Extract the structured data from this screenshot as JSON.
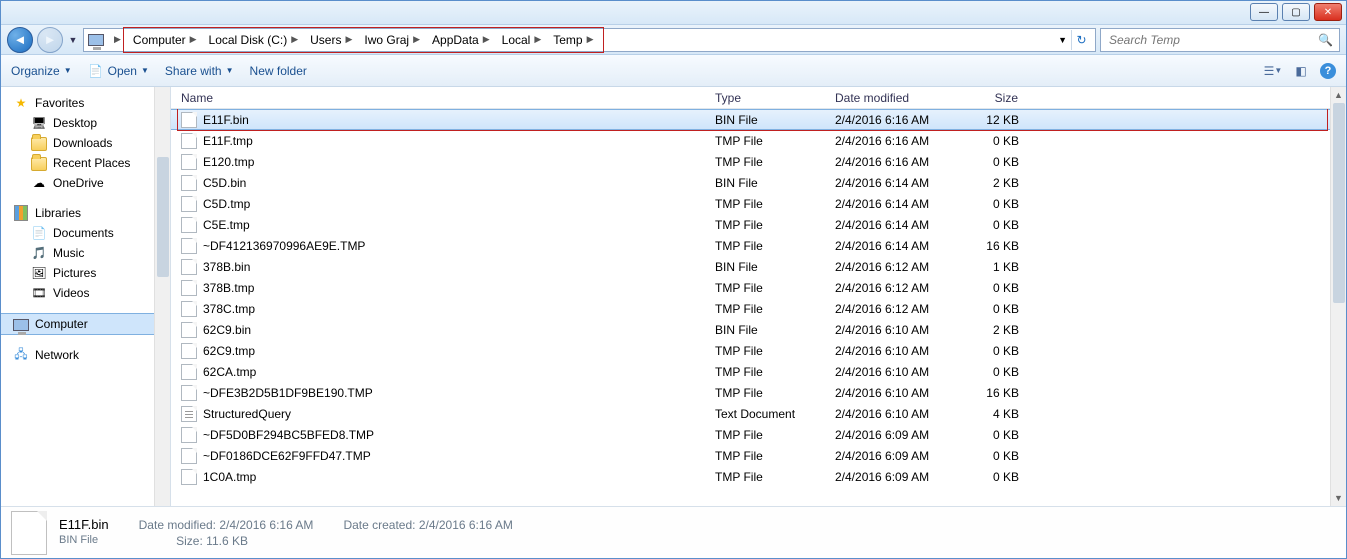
{
  "window": {
    "min": "—",
    "max": "▢",
    "close": "✕"
  },
  "breadcrumbs": [
    "Computer",
    "Local Disk (C:)",
    "Users",
    "Iwo Graj",
    "AppData",
    "Local",
    "Temp"
  ],
  "search": {
    "placeholder": "Search Temp"
  },
  "toolbar": {
    "organize": "Organize",
    "open": "Open",
    "share": "Share with",
    "newfolder": "New folder"
  },
  "sidebar": {
    "favorites": {
      "label": "Favorites",
      "items": [
        {
          "label": "Desktop",
          "icon": "desktop"
        },
        {
          "label": "Downloads",
          "icon": "folder"
        },
        {
          "label": "Recent Places",
          "icon": "folder"
        },
        {
          "label": "OneDrive",
          "icon": "cloud"
        }
      ]
    },
    "libraries": {
      "label": "Libraries",
      "items": [
        {
          "label": "Documents",
          "icon": "doc"
        },
        {
          "label": "Music",
          "icon": "music"
        },
        {
          "label": "Pictures",
          "icon": "pic"
        },
        {
          "label": "Videos",
          "icon": "vid"
        }
      ]
    },
    "computer": {
      "label": "Computer"
    },
    "network": {
      "label": "Network"
    }
  },
  "columns": {
    "name": "Name",
    "type": "Type",
    "date": "Date modified",
    "size": "Size"
  },
  "files": [
    {
      "name": "E11F.bin",
      "type": "BIN File",
      "date": "2/4/2016 6:16 AM",
      "size": "12 KB",
      "selected": true
    },
    {
      "name": "E11F.tmp",
      "type": "TMP File",
      "date": "2/4/2016 6:16 AM",
      "size": "0 KB"
    },
    {
      "name": "E120.tmp",
      "type": "TMP File",
      "date": "2/4/2016 6:16 AM",
      "size": "0 KB"
    },
    {
      "name": "C5D.bin",
      "type": "BIN File",
      "date": "2/4/2016 6:14 AM",
      "size": "2 KB"
    },
    {
      "name": "C5D.tmp",
      "type": "TMP File",
      "date": "2/4/2016 6:14 AM",
      "size": "0 KB"
    },
    {
      "name": "C5E.tmp",
      "type": "TMP File",
      "date": "2/4/2016 6:14 AM",
      "size": "0 KB"
    },
    {
      "name": "~DF412136970996AE9E.TMP",
      "type": "TMP File",
      "date": "2/4/2016 6:14 AM",
      "size": "16 KB"
    },
    {
      "name": "378B.bin",
      "type": "BIN File",
      "date": "2/4/2016 6:12 AM",
      "size": "1 KB"
    },
    {
      "name": "378B.tmp",
      "type": "TMP File",
      "date": "2/4/2016 6:12 AM",
      "size": "0 KB"
    },
    {
      "name": "378C.tmp",
      "type": "TMP File",
      "date": "2/4/2016 6:12 AM",
      "size": "0 KB"
    },
    {
      "name": "62C9.bin",
      "type": "BIN File",
      "date": "2/4/2016 6:10 AM",
      "size": "2 KB"
    },
    {
      "name": "62C9.tmp",
      "type": "TMP File",
      "date": "2/4/2016 6:10 AM",
      "size": "0 KB"
    },
    {
      "name": "62CA.tmp",
      "type": "TMP File",
      "date": "2/4/2016 6:10 AM",
      "size": "0 KB"
    },
    {
      "name": "~DFE3B2D5B1DF9BE190.TMP",
      "type": "TMP File",
      "date": "2/4/2016 6:10 AM",
      "size": "16 KB"
    },
    {
      "name": "StructuredQuery",
      "type": "Text Document",
      "date": "2/4/2016 6:10 AM",
      "size": "4 KB",
      "texticon": true
    },
    {
      "name": "~DF5D0BF294BC5BFED8.TMP",
      "type": "TMP File",
      "date": "2/4/2016 6:09 AM",
      "size": "0 KB"
    },
    {
      "name": "~DF0186DCE62F9FFD47.TMP",
      "type": "TMP File",
      "date": "2/4/2016 6:09 AM",
      "size": "0 KB"
    },
    {
      "name": "1C0A.tmp",
      "type": "TMP File",
      "date": "2/4/2016 6:09 AM",
      "size": "0 KB"
    }
  ],
  "details": {
    "name": "E11F.bin",
    "type": "BIN File",
    "modified_label": "Date modified:",
    "modified": "2/4/2016 6:16 AM",
    "created_label": "Date created:",
    "created": "2/4/2016 6:16 AM",
    "size_label": "Size:",
    "size": "11.6 KB"
  }
}
